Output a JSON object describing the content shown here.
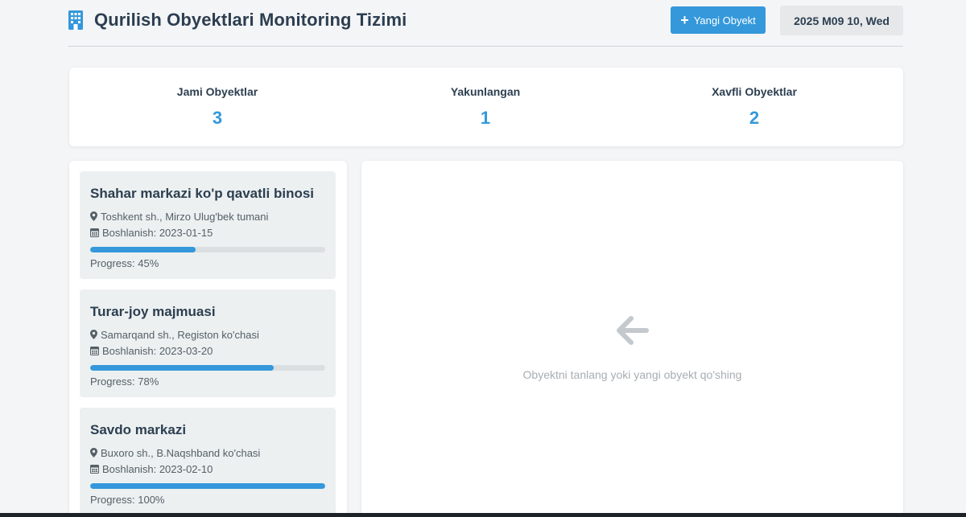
{
  "header": {
    "title": "Qurilish Obyektlari Monitoring Tizimi",
    "title_icon": "building-icon",
    "new_button_label": "Yangi Obyekt",
    "date": "2025 M09 10, Wed"
  },
  "stats": [
    {
      "label": "Jami Obyektlar",
      "value": "3"
    },
    {
      "label": "Yakunlangan",
      "value": "1"
    },
    {
      "label": "Xavfli Obyektlar",
      "value": "2"
    }
  ],
  "objects": [
    {
      "name": "Shahar markazi ko'p qavatli binosi",
      "location": "Toshkent sh., Mirzo Ulug'bek tumani",
      "start": "Boshlanish: 2023-01-15",
      "progress": 45,
      "progress_text": "Progress: 45%"
    },
    {
      "name": "Turar-joy majmuasi",
      "location": "Samarqand sh., Registon ko'chasi",
      "start": "Boshlanish: 2023-03-20",
      "progress": 78,
      "progress_text": "Progress: 78%"
    },
    {
      "name": "Savdo markazi",
      "location": "Buxoro sh., B.Naqshband ko'chasi",
      "start": "Boshlanish: 2023-02-10",
      "progress": 100,
      "progress_text": "Progress: 100%"
    }
  ],
  "detail": {
    "empty_text": "Obyektni tanlang yoki yangi obyekt qo'shing",
    "icon": "arrow-left-icon"
  },
  "colors": {
    "accent": "#3498db",
    "text": "#2c3e50",
    "card_bg": "#ecf0f1"
  }
}
